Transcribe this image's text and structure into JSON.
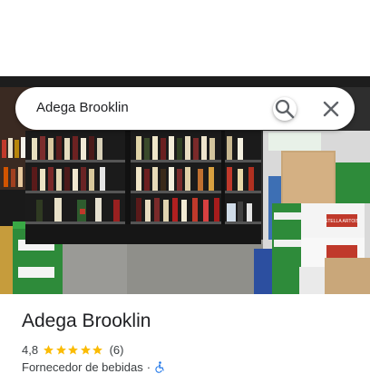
{
  "search": {
    "query": "Adega Brooklin",
    "search_icon": "search-icon",
    "close_icon": "close-icon"
  },
  "place": {
    "name": "Adega Brooklin",
    "rating": "4,8",
    "stars": 5,
    "review_count": "(6)",
    "category": "Fornecedor de bebidas",
    "separator": "·",
    "accessibility_icon": "wheelchair-icon"
  },
  "colors": {
    "star": "#fbbc04",
    "accessibility": "#1a73e8",
    "text_primary": "#202124",
    "text_secondary": "#3c4043"
  },
  "photo": {
    "sign_text": "STELLA ARTOIS"
  }
}
